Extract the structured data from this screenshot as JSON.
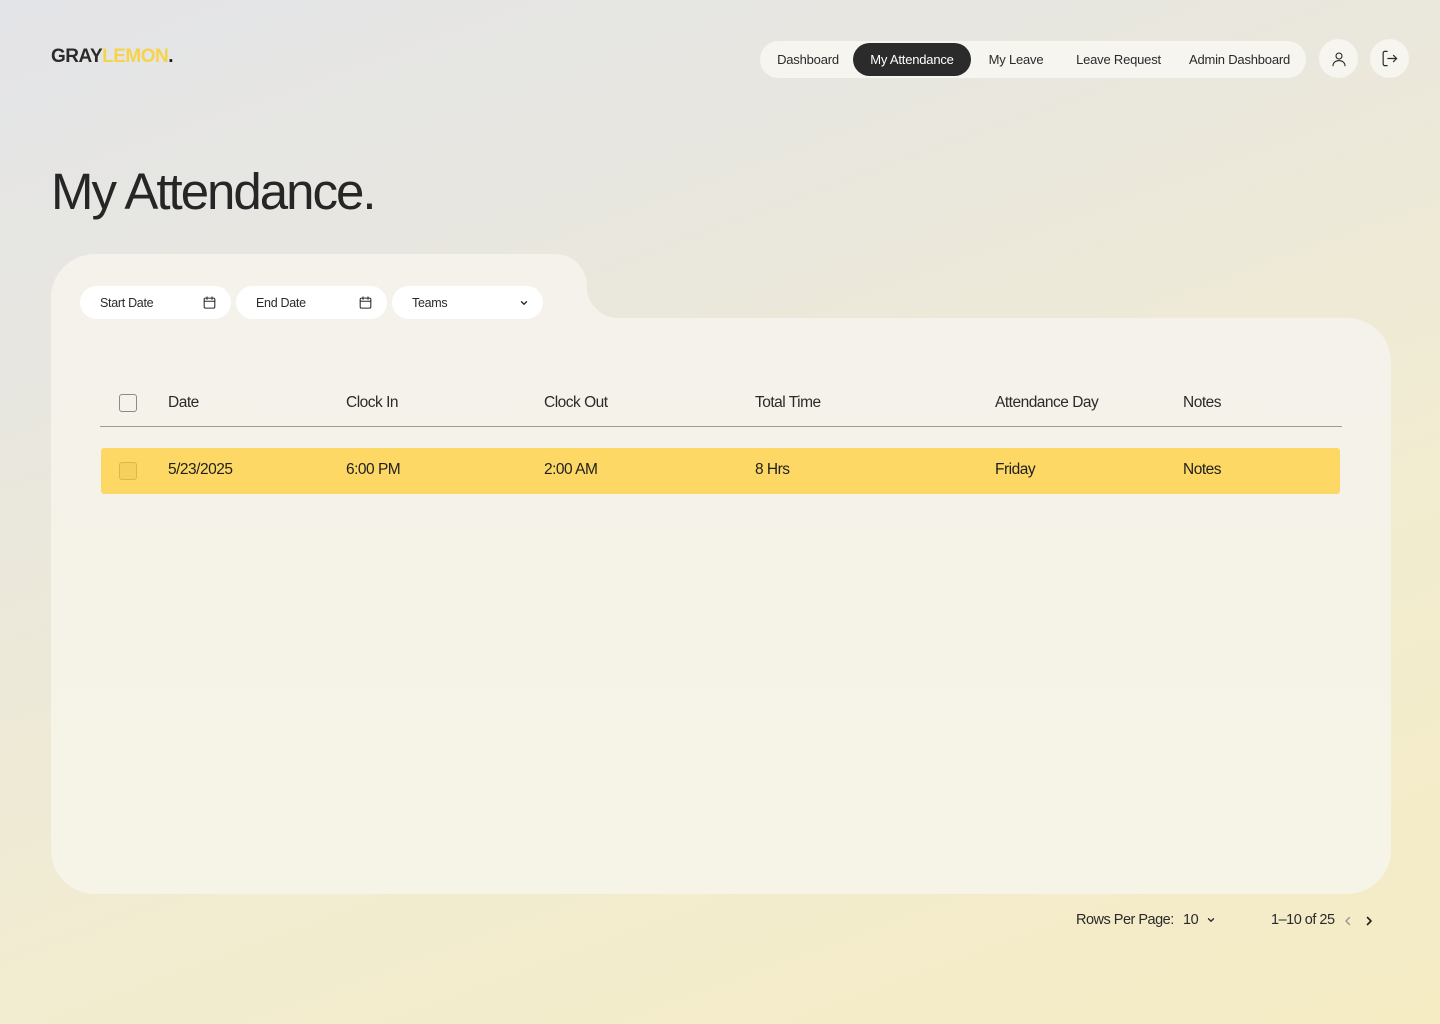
{
  "brand": {
    "part1": "GRAY",
    "part2": "LEMON",
    "dot": "."
  },
  "nav": {
    "items": [
      {
        "label": "Dashboard",
        "active": false
      },
      {
        "label": "My Attendance",
        "active": true
      },
      {
        "label": "My Leave",
        "active": false
      },
      {
        "label": "Leave Request",
        "active": false
      },
      {
        "label": "Admin Dashboard",
        "active": false
      }
    ],
    "icons": [
      "user-icon",
      "logout-icon"
    ]
  },
  "page": {
    "title": "My Attendance."
  },
  "filters": {
    "start_date": {
      "placeholder": "Start Date",
      "icon": "calendar-icon"
    },
    "end_date": {
      "placeholder": "End Date",
      "icon": "calendar-icon"
    },
    "teams": {
      "placeholder": "Teams",
      "icon": "chevron-down-icon"
    }
  },
  "table": {
    "columns": [
      "Date",
      "Clock In",
      "Clock Out",
      "Total Time",
      "Attendance Day",
      "Notes"
    ],
    "rows": [
      {
        "date": "5/23/2025",
        "clock_in": "6:00 PM",
        "clock_out": "2:00 AM",
        "total_time": "8 Hrs",
        "day": "Friday",
        "notes": "Notes",
        "selected": false
      }
    ]
  },
  "pagination": {
    "rows_per_page_label": "Rows Per Page:",
    "rows_per_page_value": "10",
    "range": "1–10 of 25"
  },
  "colors": {
    "accent": "#fdd865",
    "brand_yellow": "#f7d24c",
    "active_nav": "#2b2b2b"
  }
}
